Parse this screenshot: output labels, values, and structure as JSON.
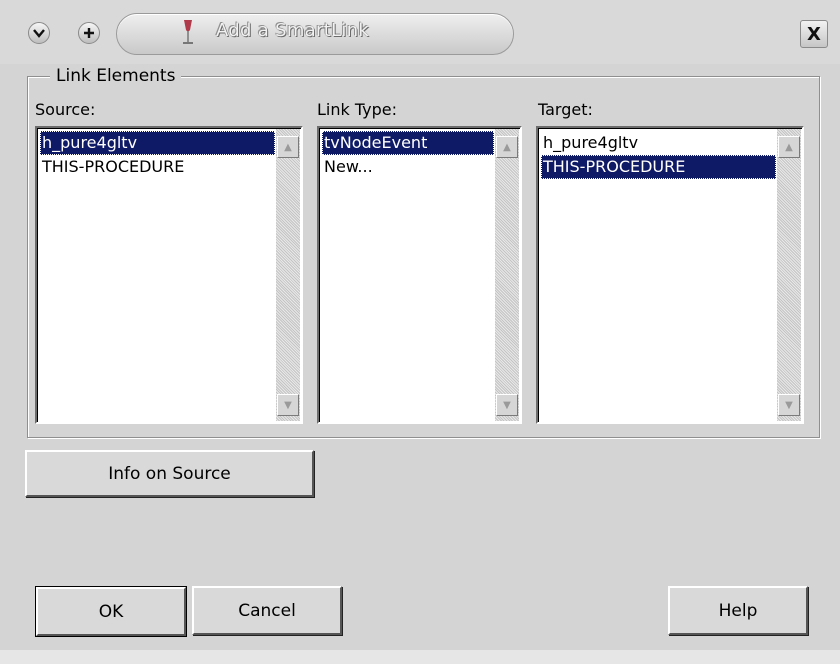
{
  "window": {
    "title": "Add a SmartLink",
    "controls": {
      "menu_icon": "chevron-down-icon",
      "add_icon": "plus-icon",
      "close_label": "X"
    }
  },
  "group": {
    "legend": "Link Elements",
    "source": {
      "label": "Source:",
      "items": [
        "h_pure4gltv",
        "THIS-PROCEDURE"
      ],
      "selected_index": 0
    },
    "link_type": {
      "label": "Link Type:",
      "items": [
        "tvNodeEvent",
        "New..."
      ],
      "selected_index": 0
    },
    "target": {
      "label": "Target:",
      "items": [
        "h_pure4gltv",
        "THIS-PROCEDURE"
      ],
      "selected_index": 1
    }
  },
  "buttons": {
    "info_on_source": "Info on Source",
    "ok": "OK",
    "cancel": "Cancel",
    "help": "Help"
  },
  "colors": {
    "selection_bg": "#0f1a66",
    "dialog_bg": "#d4d4d4"
  }
}
